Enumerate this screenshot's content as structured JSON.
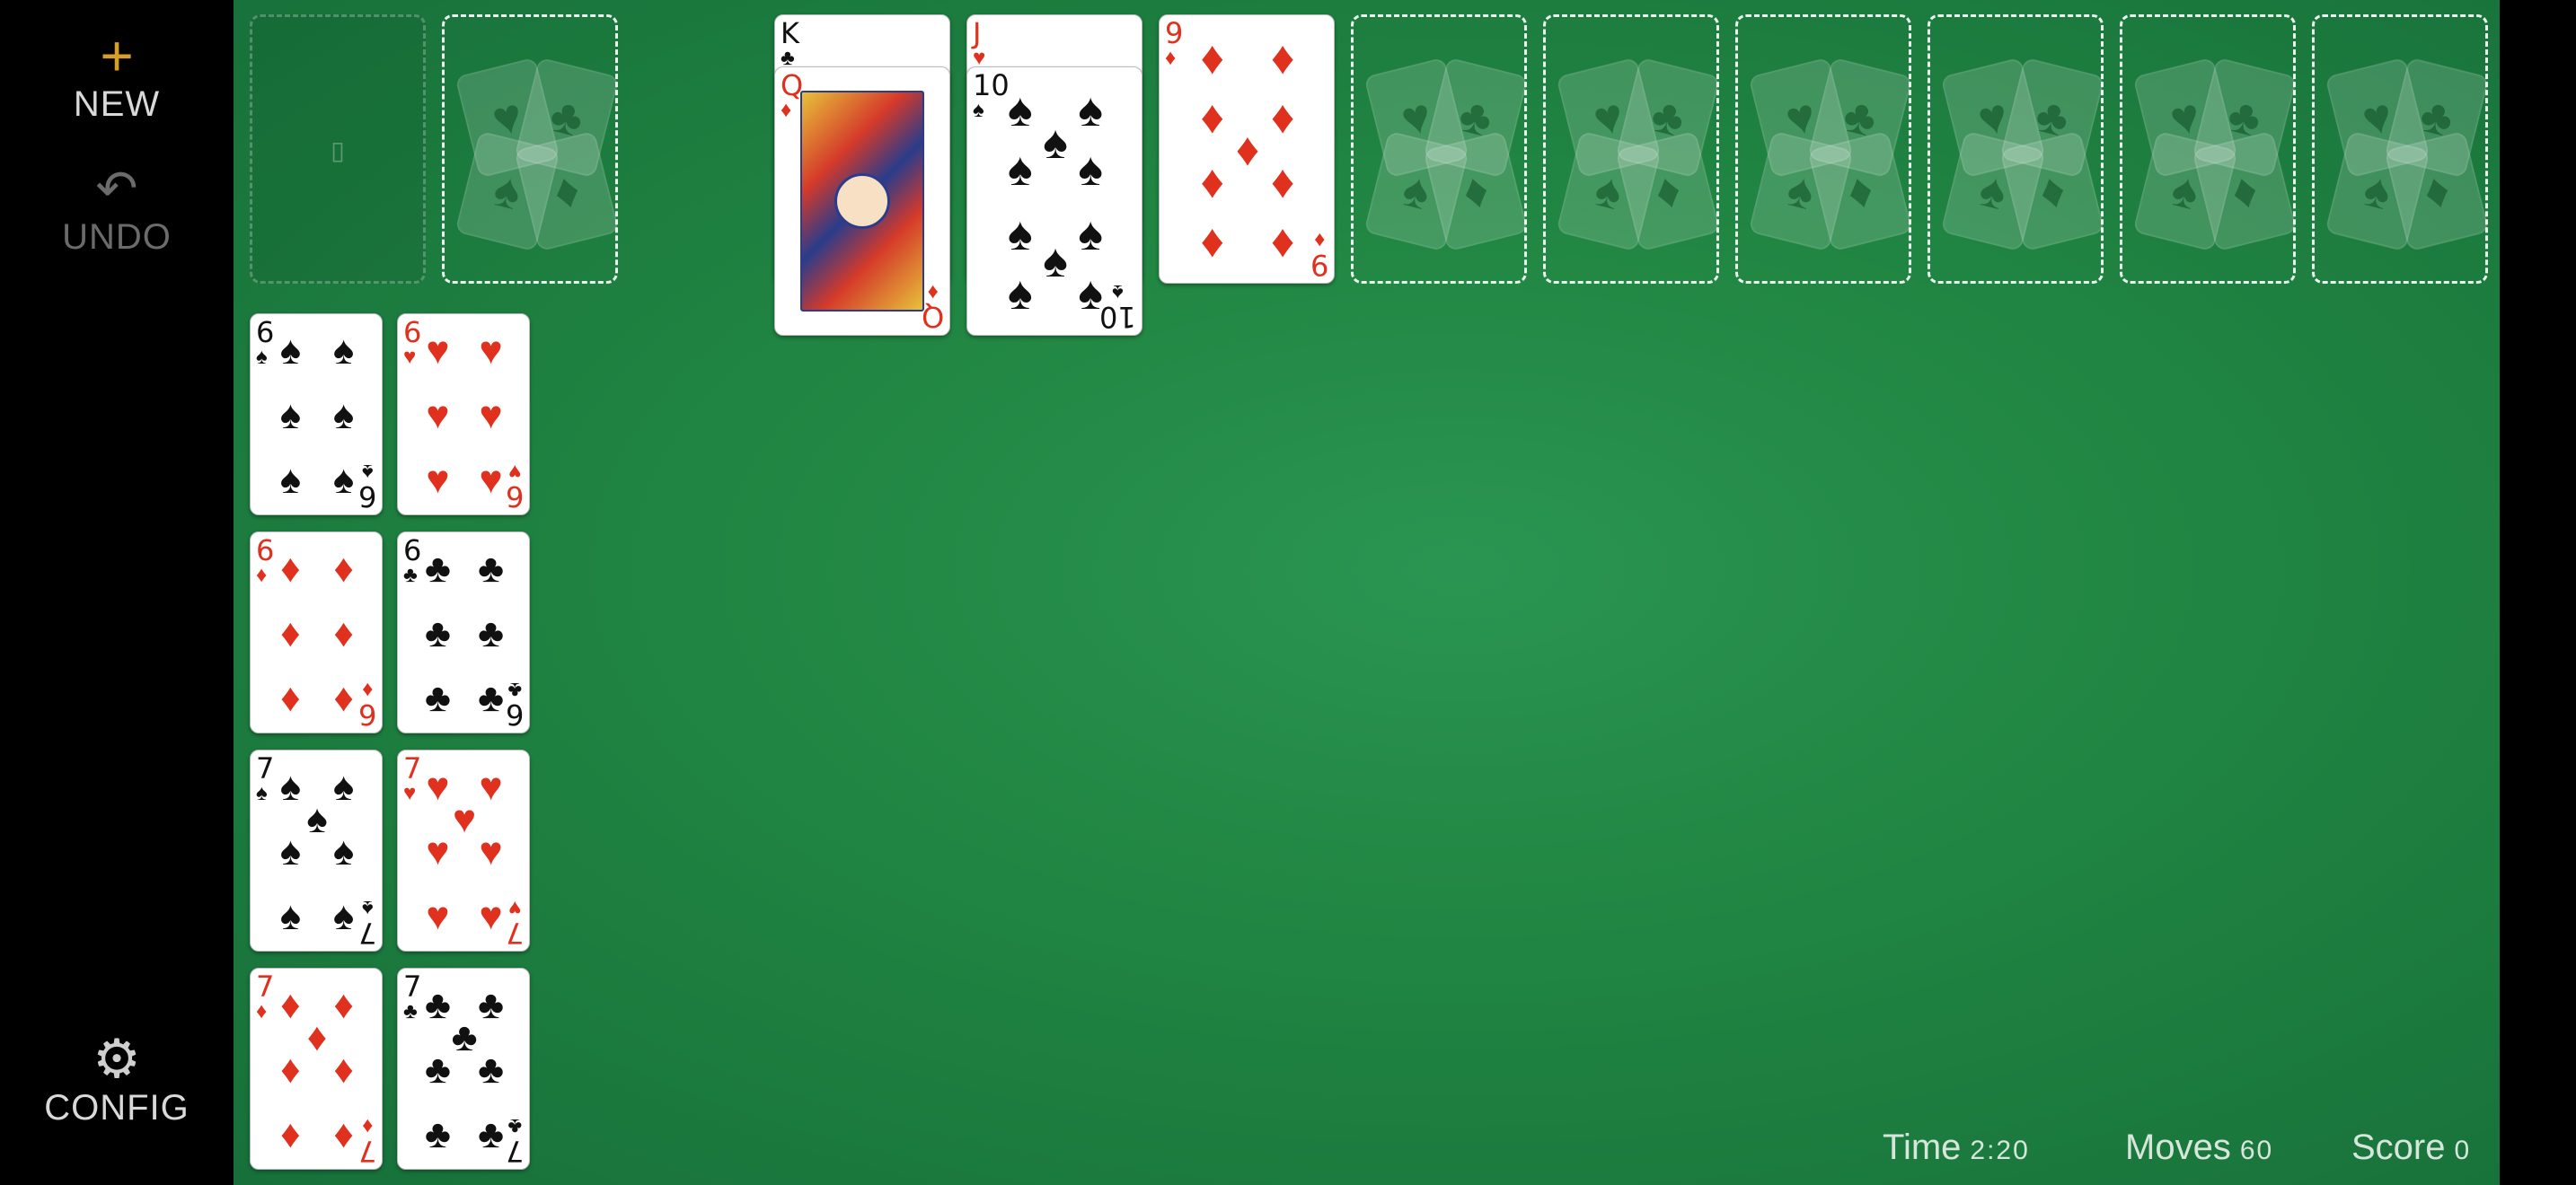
{
  "sidebar": {
    "new_icon": "+",
    "new_label": "NEW",
    "undo_icon": "↶",
    "undo_label": "UNDO",
    "config_icon": "⚙",
    "config_label": "CONFIG"
  },
  "stock": {
    "mark": "▯"
  },
  "top_cards": [
    {
      "rank": "K",
      "suit": "♣",
      "color": "black"
    },
    {
      "rank": "Q",
      "suit": "♦",
      "color": "red"
    },
    {
      "rank": "J",
      "suit": "♥",
      "color": "red"
    },
    {
      "rank": "10",
      "suit": "♠",
      "color": "black"
    },
    {
      "rank": "9",
      "suit": "♦",
      "color": "red"
    }
  ],
  "reserve_cards": [
    {
      "rank": "6",
      "suit": "♠",
      "color": "black"
    },
    {
      "rank": "6",
      "suit": "♥",
      "color": "red"
    },
    {
      "rank": "6",
      "suit": "♦",
      "color": "red"
    },
    {
      "rank": "6",
      "suit": "♣",
      "color": "black"
    },
    {
      "rank": "7",
      "suit": "♠",
      "color": "black"
    },
    {
      "rank": "7",
      "suit": "♥",
      "color": "red"
    },
    {
      "rank": "7",
      "suit": "♦",
      "color": "red"
    },
    {
      "rank": "7",
      "suit": "♣",
      "color": "black"
    }
  ],
  "status": {
    "time_label": "Time",
    "time_value": "2:20",
    "moves_label": "Moves",
    "moves_value": "60",
    "score_label": "Score",
    "score_value": "0"
  }
}
